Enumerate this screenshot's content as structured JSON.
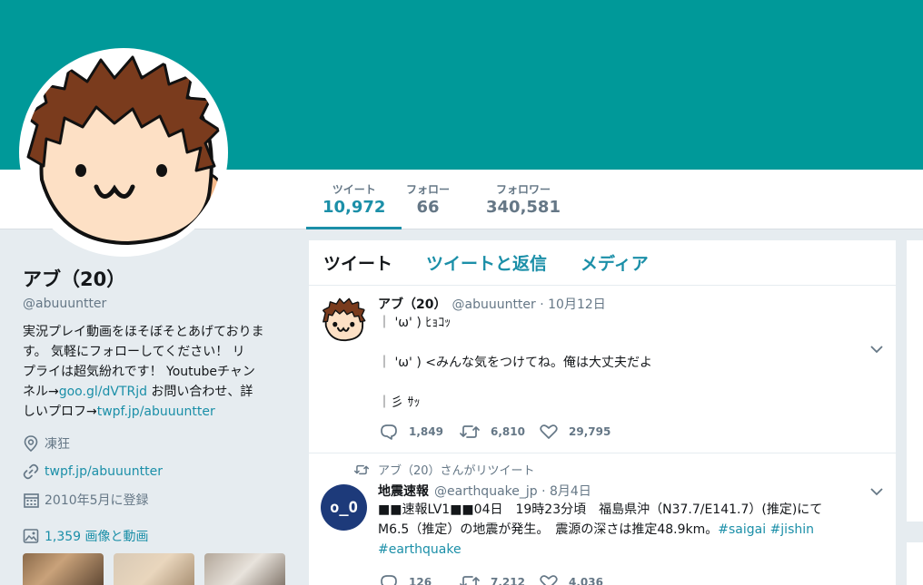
{
  "colors": {
    "banner": "#009999",
    "accent": "#1b8fa8"
  },
  "nav": {
    "stats": [
      {
        "label": "ツイート",
        "value": "10,972",
        "active": true
      },
      {
        "label": "フォロー",
        "value": "66",
        "active": false
      },
      {
        "label": "フォロワー",
        "value": "340,581",
        "active": false
      }
    ]
  },
  "profile": {
    "name": "アブ（20）",
    "handle": "@abuuuntter",
    "bio": {
      "line1": "実況プレイ動画をほそぼそとあげておりま",
      "line2": "す。 気軽にフォローしてください！ リ",
      "line3": "プライは超気紛れです！ Youtubeチャン",
      "line4_prefix": "ネル→",
      "link1": "goo.gl/dVTRjd",
      "line4_suffix": " お問い合わせ、詳",
      "line5_prefix": "しいプロフ→",
      "link2": "twpf.jp/abuuuntter"
    },
    "location": "凍狂",
    "url": "twpf.jp/abuuuntter",
    "joined": "2010年5月に登録",
    "media": "1,359 画像と動画",
    "icons": {
      "location": "location-pin-icon",
      "url": "link-icon",
      "joined": "calendar-icon",
      "media": "image-icon"
    }
  },
  "timeline": {
    "tabs": [
      "ツイート",
      "ツイートと返信",
      "メディア"
    ],
    "tweets": [
      {
        "name": "アブ（20）",
        "handle": "@abuuuntter",
        "date": "· 10月12日",
        "lines": [
          "｜ 'ω' ) ﾋｮｺｯ",
          "",
          "｜ 'ω' ) <みんな気をつけてね。俺は大丈夫だよ",
          "",
          "｜彡 ｻｯ"
        ],
        "replies": "1,849",
        "retweets": "6,810",
        "likes": "29,795"
      },
      {
        "retweet_by": "アブ（20）さんがリツイート",
        "name": "地震速報",
        "handle": "@earthquake_jp",
        "date": "· 8月4日",
        "line1": "■■速報LV1■■04日　19時23分頃　福島県沖（N37.7/E141.7）(推定)にて",
        "line2_text": "M6.5（推定）の地震が発生。　震源の深さは推定48.9km。",
        "line2_tags": "#saigai #jishin",
        "line3_tags": "#earthquake",
        "avatar_text": "o_O",
        "replies": "126",
        "retweets": "7,212",
        "likes": "4,036"
      }
    ]
  }
}
